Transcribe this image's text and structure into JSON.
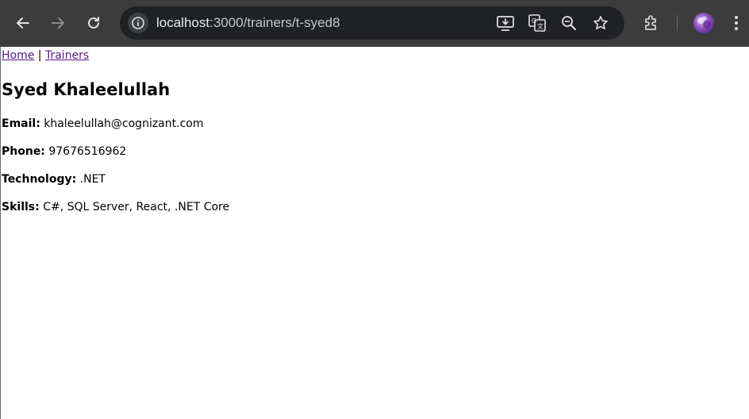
{
  "browser": {
    "url_host": "localhost",
    "url_path": ":3000/trainers/t-syed8",
    "icons": [
      "back-arrow-icon",
      "forward-arrow-icon",
      "reload-icon",
      "site-info-icon",
      "install-app-icon",
      "translate-icon",
      "zoom-icon",
      "bookmark-star-icon",
      "extensions-icon",
      "profile-avatar",
      "more-menu-icon"
    ]
  },
  "nav": {
    "home_label": "Home",
    "separator": " | ",
    "trainers_label": "Trainers"
  },
  "trainer": {
    "name": "Syed Khaleelullah",
    "email_label": "Email:",
    "email_value": "khaleelullah@cognizant.com",
    "phone_label": "Phone:",
    "phone_value": "97676516962",
    "technology_label": "Technology:",
    "technology_value": ".NET",
    "skills_label": "Skills:",
    "skills_value": "C#, SQL Server, React, .NET Core"
  },
  "colors": {
    "toolbar_bg": "#3c3c3c",
    "omnibox_bg": "#202124",
    "visited_link": "#551a8b"
  }
}
